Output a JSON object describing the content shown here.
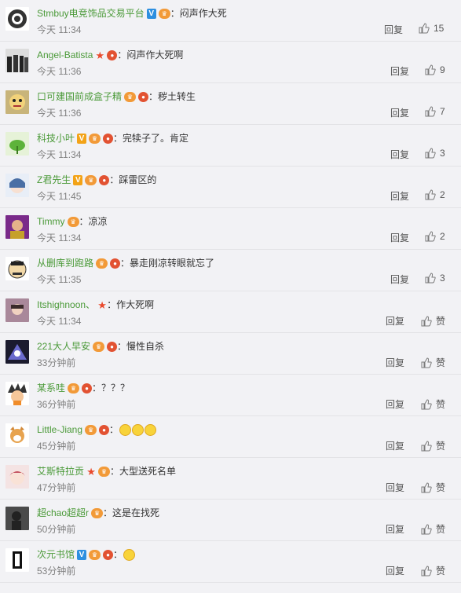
{
  "ui": {
    "reply_label": "回复",
    "like_label": "赞",
    "separator": "："
  },
  "comments": [
    {
      "user": "Stmbuy电竞饰品交易平台",
      "badges": [
        "v-blue",
        "vip"
      ],
      "text": "闷声作大死",
      "time": "今天 11:34",
      "likes": "15",
      "avatar": "camera-logo"
    },
    {
      "user": "Angel-Batista",
      "badges": [
        "star",
        "hong"
      ],
      "text": "闷声作大死啊",
      "time": "今天 11:36",
      "likes": "9",
      "avatar": "band-photo"
    },
    {
      "user": "口可建国前成盒子精",
      "badges": [
        "vip",
        "hong"
      ],
      "text": "秽土转生",
      "time": "今天 11:36",
      "likes": "7",
      "avatar": "cartoon-face"
    },
    {
      "user": "科技小叶",
      "badges": [
        "v-yellow",
        "vip",
        "hong"
      ],
      "text": "完犊子了。肯定",
      "time": "今天 11:34",
      "likes": "3",
      "avatar": "green-leaf"
    },
    {
      "user": "Z君先生",
      "badges": [
        "v-yellow",
        "vip",
        "hong"
      ],
      "text": "踩雷区的",
      "time": "今天 11:45",
      "likes": "2",
      "avatar": "anime-girl"
    },
    {
      "user": "Timmy",
      "badges": [
        "vip"
      ],
      "text": "凉凉",
      "time": "今天 11:34",
      "likes": "2",
      "avatar": "purple-photo"
    },
    {
      "user": "从删库到跑路",
      "badges": [
        "vip",
        "hong"
      ],
      "text": "暴走刚凉转眼就忘了",
      "time": "今天 11:35",
      "likes": "3",
      "avatar": "comic-face"
    },
    {
      "user": "Itshighnoon、",
      "badges": [
        "star"
      ],
      "text": "作大死啊",
      "time": "今天 11:34",
      "likes": "赞",
      "avatar": "girl-photo"
    },
    {
      "user": "221大人早安",
      "badges": [
        "vip",
        "hong"
      ],
      "text": "慢性自杀",
      "time": "33分钟前",
      "likes": "赞",
      "avatar": "dark-art"
    },
    {
      "user": "某系哇",
      "badges": [
        "vip",
        "hong"
      ],
      "text": "？？？",
      "time": "36分钟前",
      "likes": "赞",
      "avatar": "anime-spiky"
    },
    {
      "user": "Little-Jiang",
      "badges": [
        "vip",
        "hong"
      ],
      "text": "",
      "time": "45分钟前",
      "likes": "赞",
      "avatar": "shiba-dog",
      "emojis": 3
    },
    {
      "user": "艾斯特拉贡",
      "badges": [
        "star",
        "vip"
      ],
      "text": "大型送死名单",
      "time": "47分钟前",
      "likes": "赞",
      "avatar": "anime-pink"
    },
    {
      "user": "超chao超超r",
      "badges": [
        "vip"
      ],
      "text": "这是在找死",
      "time": "50分钟前",
      "likes": "赞",
      "avatar": "dark-silhouette"
    },
    {
      "user": "次元书馆",
      "badges": [
        "v-blue",
        "vip",
        "hong"
      ],
      "text": "",
      "time": "53分钟前",
      "likes": "赞",
      "avatar": "door-logo",
      "emojis": 1
    }
  ],
  "colors": {
    "name": "#4b9a39",
    "time": "#808080",
    "background": "#f2f2f5"
  }
}
